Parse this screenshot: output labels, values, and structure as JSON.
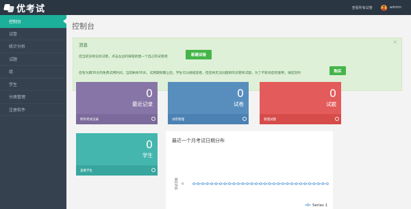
{
  "app": {
    "logo_text": "优考试"
  },
  "header": {
    "link": "查看所有试卷",
    "user": "admin"
  },
  "sidebar": {
    "items": [
      {
        "label": "控制台"
      },
      {
        "label": "试卷"
      },
      {
        "label": "统计分析"
      },
      {
        "label": "试题"
      },
      {
        "label": "组"
      },
      {
        "label": "学生"
      },
      {
        "label": "分类管理"
      },
      {
        "label": "注册软件"
      }
    ]
  },
  "main": {
    "title": "控制台",
    "alert": {
      "title": "消息",
      "close": "×",
      "line1": "您当前没有任何试卷，点击左边的按钮新建一个自己的试卷吧",
      "new_paper_button": "新建试卷",
      "line2": "您有为期30天的免费试用时间，当前剩余30天，试用期到期之后，学生可以继续答卷，但您将无法创建新的试卷和试题，为了不影响您的使用，请您及时",
      "buy_button": "购买"
    },
    "tiles": [
      {
        "count": "0",
        "label": "最近记录",
        "footer": "所有考试记录"
      },
      {
        "count": "0",
        "label": "试卷",
        "footer": "试卷管理"
      },
      {
        "count": "0",
        "label": "试题",
        "footer": "管理试题"
      },
      {
        "count": "0",
        "label": "学生",
        "footer": "查看学生"
      }
    ],
    "chart_title": "最近一个月考试日期分布"
  },
  "chart_data": {
    "type": "line",
    "title": "最近一个月考试日期分布",
    "ylabel": "测试次数",
    "ytick": "0",
    "series": [
      {
        "name": "Series 1",
        "values": [
          0,
          0,
          0,
          0,
          0,
          0,
          0,
          0,
          0,
          0,
          0,
          0,
          0,
          0,
          0,
          0,
          0,
          0,
          0,
          0,
          0,
          0,
          0,
          0,
          0,
          0,
          0,
          0,
          0,
          0,
          0
        ]
      }
    ],
    "legend_position": "bottom-right",
    "color": "#4a90d9"
  }
}
